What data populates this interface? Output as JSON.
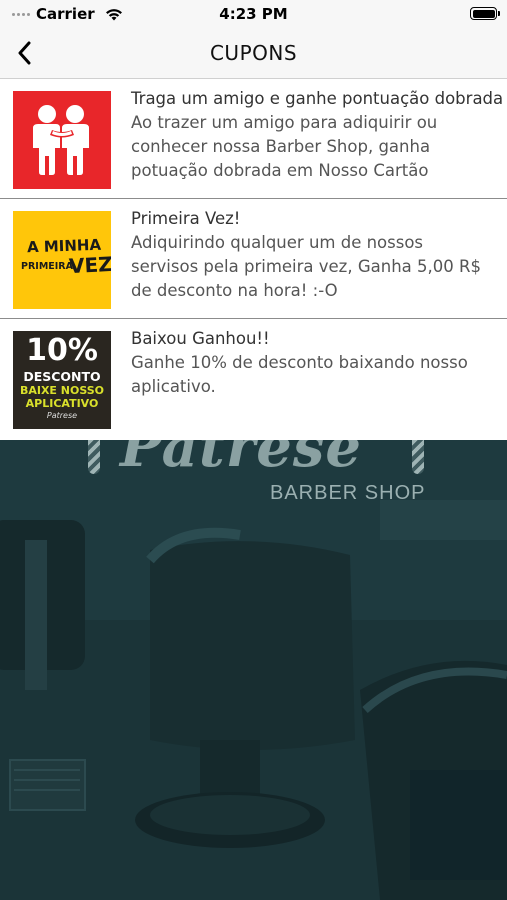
{
  "status_bar": {
    "carrier": "Carrier",
    "time": "4:23 PM"
  },
  "nav": {
    "title": "CUPONS",
    "back_icon": "chevron-left-icon"
  },
  "coupons": [
    {
      "title": "Traga um amigo e ganhe pontuação dobrada",
      "description_lines": [
        "Ao trazer um amigo para adiquirir ou",
        "conhecer nossa Barber Shop, ganha",
        "potuação dobrada em Nosso Cartão"
      ],
      "image_icon": "friends-icon",
      "color": "#e8262a"
    },
    {
      "title": "Primeira Vez!",
      "description_lines": [
        "Adiquirindo qualquer um de nossos",
        "servisos pela primeira vez, Ganha 5,00 R$",
        "de desconto na hora! :-O"
      ],
      "image_text": {
        "line1": "A MINHA",
        "line2a": "PRIMEIRA",
        "line2b": "VEZ"
      },
      "color": "#ffc60a"
    },
    {
      "title": "Baixou Ganhou!!",
      "description_lines": [
        "Ganhe 10% de desconto baixando nosso",
        "aplicativo."
      ],
      "image_text": {
        "line1": "10%",
        "line2": "DESCONTO",
        "line3": "BAIXE NOSSO",
        "line4": "APLICATIVO",
        "line5": "Patrese"
      },
      "color": "#2a2620"
    }
  ],
  "background": {
    "brand": "Patrese",
    "subtitle": "BARBER SHOP"
  }
}
